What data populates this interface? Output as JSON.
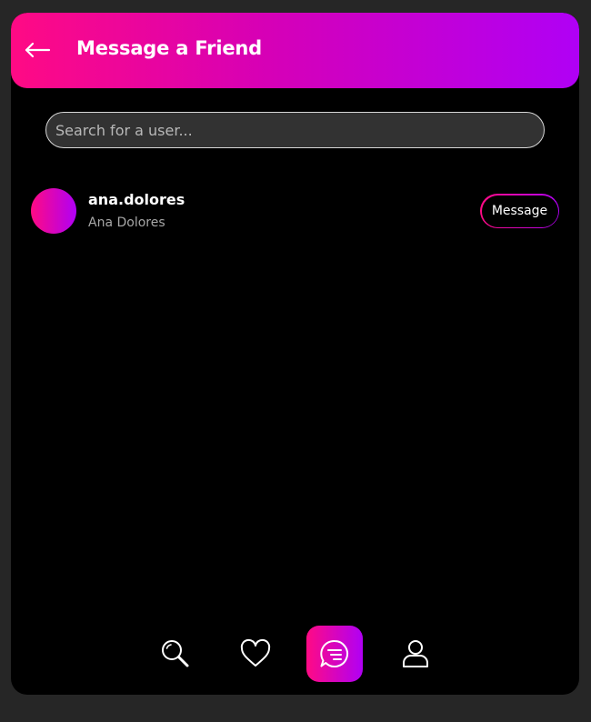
{
  "header": {
    "back_icon": "arrow-left-icon",
    "title": "Message a Friend"
  },
  "search": {
    "placeholder": "Search for a user...",
    "value": ""
  },
  "users": [
    {
      "username": "ana.dolores",
      "full_name": "Ana Dolores",
      "action_label": "Message"
    }
  ],
  "nav": {
    "items": [
      {
        "icon": "search-icon",
        "active": false
      },
      {
        "icon": "heart-icon",
        "active": false
      },
      {
        "icon": "chat-icon",
        "active": true
      },
      {
        "icon": "user-icon",
        "active": false
      }
    ]
  },
  "colors": {
    "accent_start": "#ff0a84",
    "accent_end": "#b000f5",
    "background": "#000000",
    "page_background": "#262626"
  }
}
